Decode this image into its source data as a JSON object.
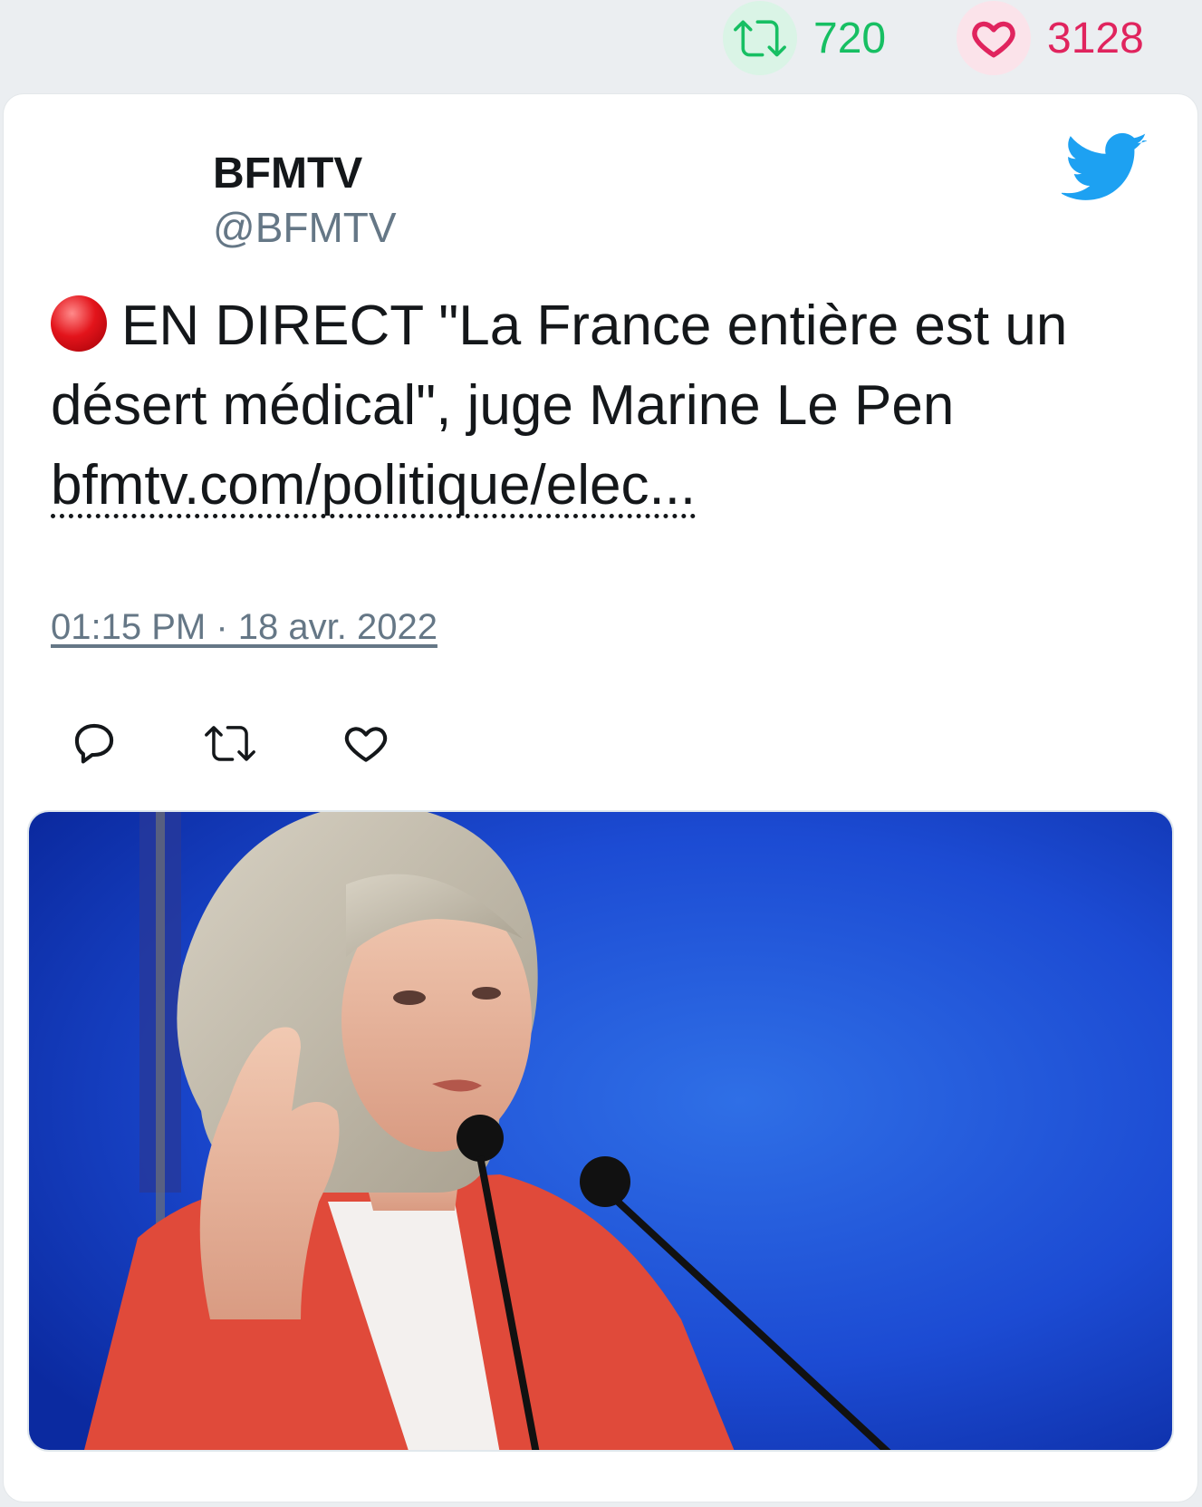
{
  "stats": {
    "retweet_count": "720",
    "like_count": "3128"
  },
  "tweet": {
    "author_name": "BFMTV",
    "author_handle": "@BFMTV",
    "live_icon": "red-circle-emoji",
    "text": "EN DIRECT \"La France entière est un désert médical\", juge Marine Le Pen",
    "link": "bfmtv.com/politique/elec...",
    "timestamp": "01:15 PM · 18 avr. 2022"
  },
  "icons": {
    "platform": "twitter-bird-icon",
    "actions": [
      "reply-icon",
      "retweet-icon",
      "like-icon"
    ]
  },
  "colors": {
    "retweet": "#17bf63",
    "like": "#e0245e",
    "twitter_blue": "#1da1f2",
    "muted_text": "#657786"
  }
}
